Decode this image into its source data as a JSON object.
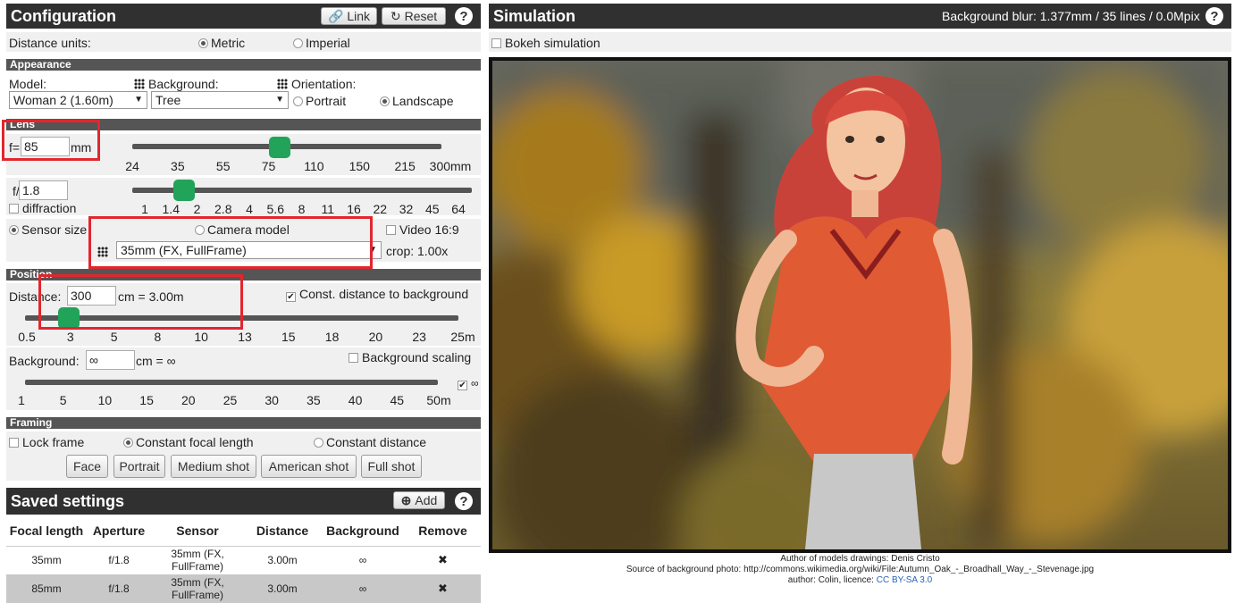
{
  "config": {
    "title": "Configuration",
    "link_label": "Link",
    "reset_label": "Reset",
    "help": "?",
    "distance_units_label": "Distance units:",
    "metric_label": "Metric",
    "imperial_label": "Imperial",
    "appearance": {
      "header": "Appearance",
      "model_label": "Model:",
      "model_value": "Woman 2 (1.60m)",
      "background_label": "Background:",
      "background_value": "Tree",
      "orientation_label": "Orientation:",
      "portrait_label": "Portrait",
      "landscape_label": "Landscape"
    },
    "lens": {
      "header": "Lens",
      "focal_prefix": "f=",
      "focal_value": "85",
      "focal_unit": "mm",
      "focal_ticks": [
        "24",
        "35",
        "55",
        "75",
        "110",
        "150",
        "215",
        "300mm"
      ],
      "focal_slider_fraction": 0.48,
      "aperture_prefix": "f/",
      "aperture_value": "1.8",
      "diffraction_label": "diffraction",
      "aperture_ticks": [
        "1",
        "1.4",
        "2",
        "2.8",
        "4",
        "5.6",
        "8",
        "11",
        "16",
        "22",
        "32",
        "45",
        "64"
      ],
      "sensor_size_label": "Sensor size",
      "camera_model_label": "Camera model",
      "video_label": "Video 16:9",
      "sensor_value": "35mm (FX, FullFrame)",
      "crop_label": "crop: 1.00x"
    },
    "position": {
      "header": "Position",
      "distance_label": "Distance:",
      "distance_value": "300",
      "distance_readout": "cm = 3.00m",
      "const_bg_label": "Const. distance to background",
      "distance_ticks": [
        "0.5",
        "3",
        "5",
        "8",
        "10",
        "13",
        "15",
        "18",
        "20",
        "23",
        "25m"
      ],
      "background_label": "Background:",
      "background_value": "∞",
      "background_readout": "cm = ∞",
      "bg_scaling_label": "Background scaling",
      "bg_ticks": [
        "1",
        "5",
        "10",
        "15",
        "20",
        "25",
        "30",
        "35",
        "40",
        "45",
        "50m"
      ],
      "infinity_label": "∞"
    },
    "framing": {
      "header": "Framing",
      "lock_frame_label": "Lock frame",
      "const_focal_label": "Constant focal length",
      "const_distance_label": "Constant distance",
      "buttons": [
        "Face",
        "Portrait",
        "Medium shot",
        "American shot",
        "Full shot"
      ]
    }
  },
  "saved": {
    "title": "Saved settings",
    "add_label": "Add",
    "help": "?",
    "columns": [
      "Focal length",
      "Aperture",
      "Sensor",
      "Distance",
      "Background",
      "Remove"
    ],
    "rows": [
      {
        "focal": "35mm",
        "aperture": "f/1.8",
        "sensor": "35mm (FX, FullFrame)",
        "distance": "3.00m",
        "background": "∞",
        "remove": "✖"
      },
      {
        "focal": "85mm",
        "aperture": "f/1.8",
        "sensor": "35mm (FX, FullFrame)",
        "distance": "3.00m",
        "background": "∞",
        "remove": "✖"
      }
    ]
  },
  "simulation": {
    "title": "Simulation",
    "blur_info": "Background blur: 1.377mm / 35 lines / 0.0Mpix",
    "help": "?",
    "bokeh_label": "Bokeh simulation",
    "credit_models": "Author of models drawings: Denis Cristo",
    "credit_photo": "Source of background photo: http://commons.wikimedia.org/wiki/File:Autumn_Oak_-_Broadhall_Way_-_Stevenage.jpg",
    "credit_author_prefix": "author: Colin, licence: ",
    "credit_licence": "CC BY-SA 3.0"
  },
  "colors": {
    "header_bg": "#303030",
    "section_bg": "#555555",
    "slider_knob": "#22a35a",
    "highlight_box": "#e2262e",
    "link": "#2a62b8"
  }
}
